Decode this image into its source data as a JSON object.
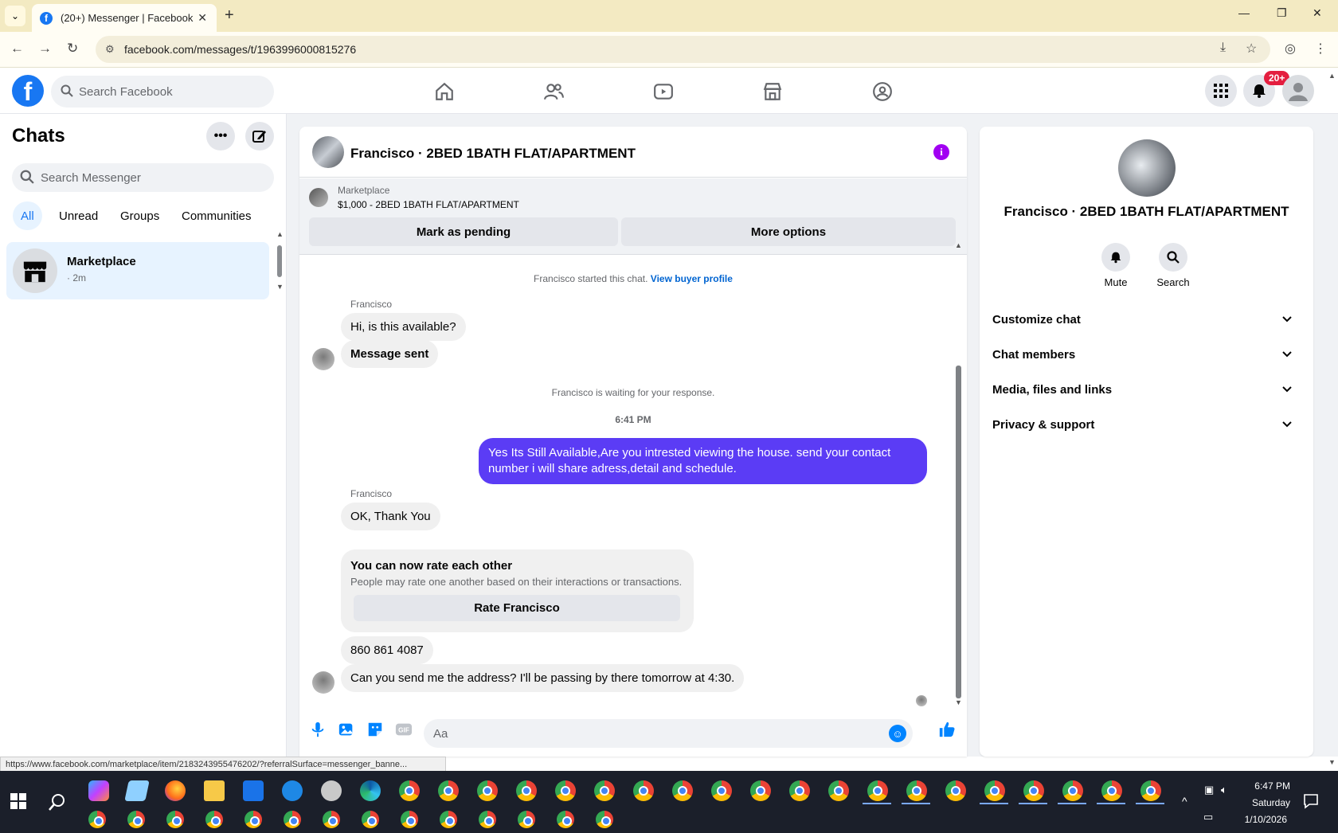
{
  "browser": {
    "tab_title": "(20+) Messenger | Facebook",
    "url": "facebook.com/messages/t/1963996000815276",
    "status_url": "https://www.facebook.com/marketplace/item/2183243955476202/?referralSurface=messenger_banne..."
  },
  "fb_header": {
    "search_placeholder": "Search Facebook",
    "notification_count": "20+"
  },
  "chats": {
    "title": "Chats",
    "search_placeholder": "Search Messenger",
    "filters": [
      "All",
      "Unread",
      "Groups",
      "Communities"
    ],
    "items": [
      {
        "name": "Marketplace",
        "time": "· 2m"
      }
    ]
  },
  "conversation": {
    "title": "Francisco · 2BED 1BATH FLAT/APARTMENT",
    "marketplace_label": "Marketplace",
    "listing": "$1,000 - 2BED 1BATH FLAT/APARTMENT",
    "mark_pending": "Mark as pending",
    "more_options": "More options",
    "started_text": "Francisco started this chat.",
    "view_buyer_profile": "View buyer profile",
    "sender_name": "Francisco",
    "msg1": "Hi, is this available?",
    "msg2": "Message sent",
    "waiting_text": "Francisco is waiting for your response.",
    "timestamp": "6:41 PM",
    "outgoing": "Yes Its Still Available,Are you intrested viewing the house. send your contact number i will share adress,detail and schedule.",
    "sender_name2": "Francisco",
    "msg3": "OK, Thank You",
    "rate_title": "You can now rate each other",
    "rate_sub": "People may rate one another based on their interactions or transactions.",
    "rate_button": "Rate Francisco",
    "msg4": "860 861 4087",
    "msg5": "Can you send me the address? I'll be passing by there tomorrow at 4:30.",
    "composer_placeholder": "Aa"
  },
  "info_panel": {
    "name": "Francisco · 2BED 1BATH FLAT/APARTMENT",
    "mute": "Mute",
    "search": "Search",
    "sections": [
      "Customize chat",
      "Chat members",
      "Media, files and links",
      "Privacy & support"
    ]
  },
  "taskbar": {
    "time": "6:47 PM",
    "day": "Saturday",
    "date": "1/10/2026"
  },
  "colors": {
    "brand": "#1877f2",
    "outgoing_bubble": "#5b3cf5",
    "info_accent": "#a100f2"
  }
}
